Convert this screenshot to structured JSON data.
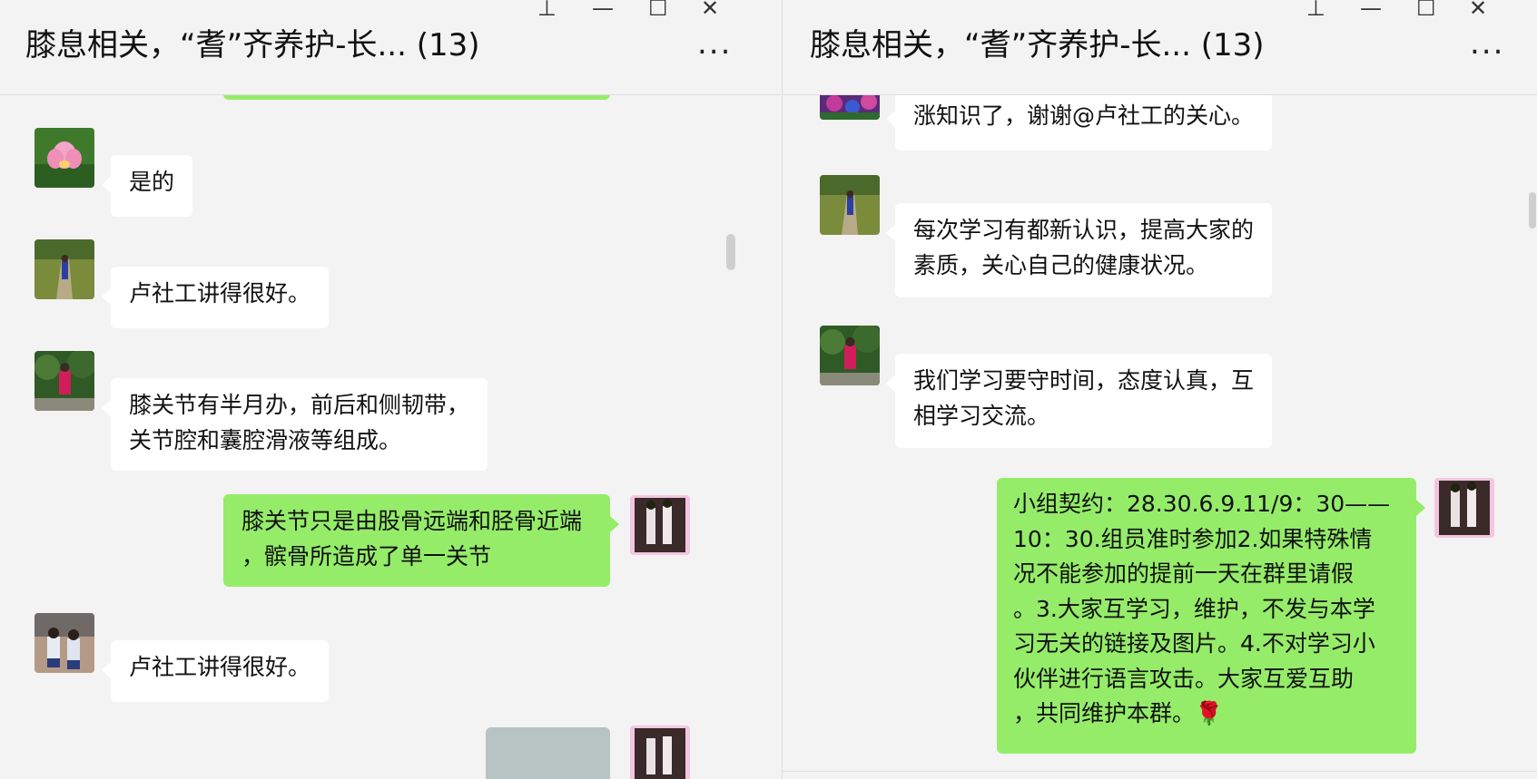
{
  "left": {
    "title": "膝息相关，“耆”齐养护-长... (13)",
    "messages": [
      {
        "lines": [
          "是的"
        ]
      },
      {
        "lines": [
          "卢社工讲得很好。"
        ]
      },
      {
        "lines": [
          "膝关节有半月办，前后和侧韧带，",
          "关节腔和囊腔滑液等组成。"
        ]
      },
      {
        "lines": [
          "膝关节只是由股骨远端和胫骨近端",
          "，髌骨所造成了单一关节"
        ]
      },
      {
        "lines": [
          "卢社工讲得很好。"
        ]
      }
    ]
  },
  "right": {
    "title": "膝息相关，“耆”齐养护-长... (13)",
    "messages": [
      {
        "lines": [
          "涨知识了，谢谢@卢社工的关心。"
        ]
      },
      {
        "lines": [
          "每次学习有都新认识，提高大家的",
          "素质，关心自己的健康状况。"
        ]
      },
      {
        "lines": [
          "我们学习要守时间，态度认真，互",
          "相学习交流。"
        ]
      },
      {
        "lines": [
          "小组契约：28.30.6.9.11/9：30——",
          "10：30.组员准时参加2.如果特殊情",
          "况不能参加的提前一天在群里请假",
          "。3.大家互学习，维护，不发与本学",
          "习无关的链接及图片。4.不对学习小",
          "伙伴进行语言攻击。大家互爱互助",
          "，共同维护本群。🌹"
        ]
      }
    ]
  },
  "controls": {
    "pin": "⊥",
    "minimize": "—",
    "maximize": "☐",
    "close": "✕",
    "more": "..."
  },
  "colors": {
    "bubble_out": "#95ec69",
    "bubble_in": "#ffffff",
    "background": "#f3f3f3"
  }
}
